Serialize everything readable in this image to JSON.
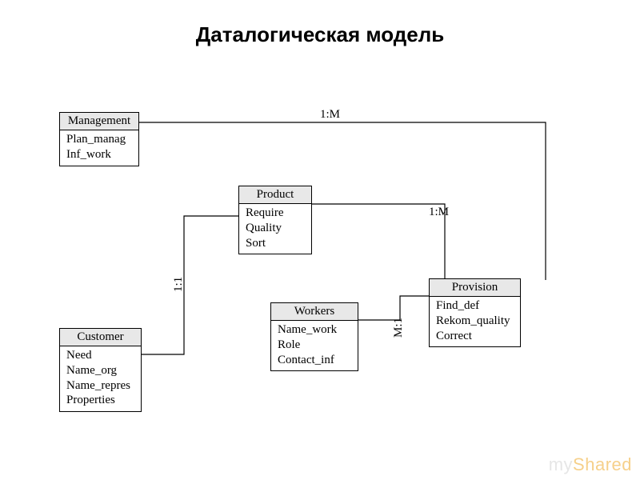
{
  "title": "Даталогическая модель",
  "entities": {
    "management": {
      "name": "Management",
      "attrs": [
        "Plan_manag",
        "Inf_work"
      ]
    },
    "product": {
      "name": "Product",
      "attrs": [
        "Require",
        "Quality",
        "Sort"
      ]
    },
    "provision": {
      "name": "Provision",
      "attrs": [
        "Find_def",
        "Rekom_quality",
        "Correct"
      ]
    },
    "customer": {
      "name": "Customer",
      "attrs": [
        "Need",
        "Name_org",
        "Name_repres",
        "Properties"
      ]
    },
    "workers": {
      "name": "Workers",
      "attrs": [
        "Name_work",
        "Role",
        "Contact_inf"
      ]
    }
  },
  "relations": {
    "management_provision": "1:M",
    "product_provision": "1:M",
    "customer_product": "1:1",
    "workers_provision": "M:1"
  },
  "watermark": {
    "pre": "my",
    "accent": "Shared"
  }
}
